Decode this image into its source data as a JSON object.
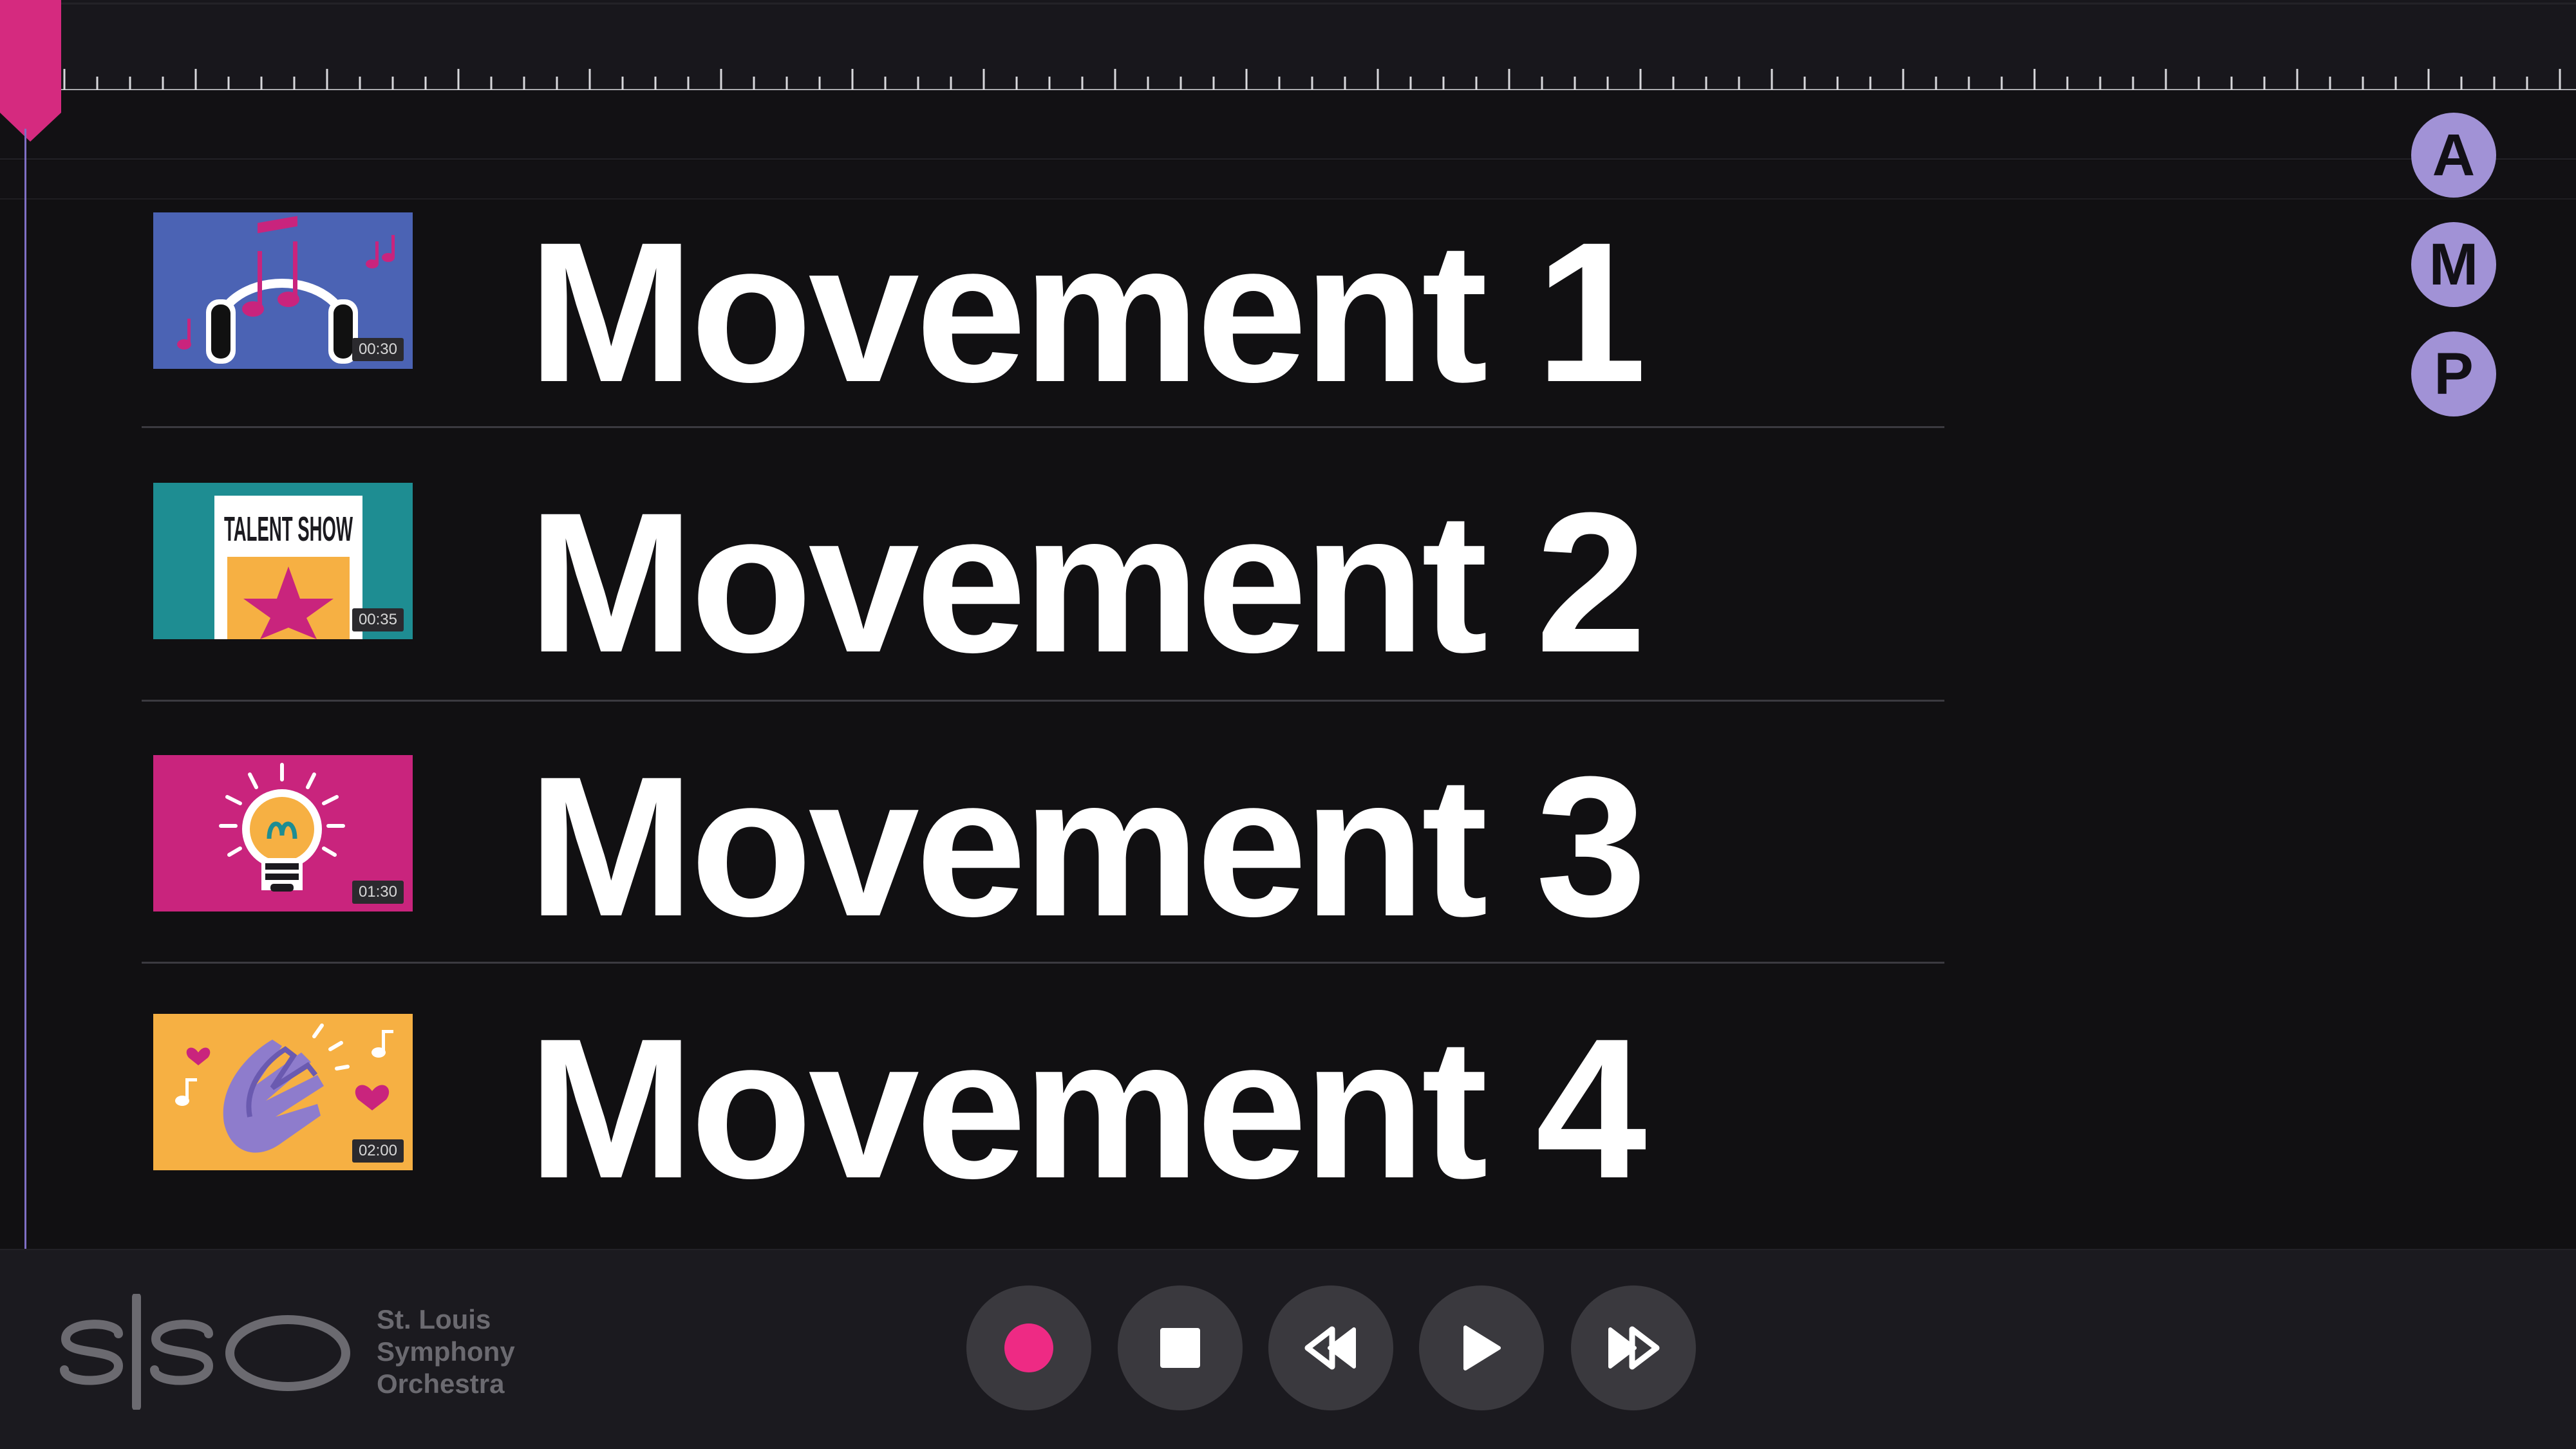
{
  "movements": [
    {
      "title": "Movement 1",
      "duration": "00:30",
      "thumbnail_icon": "headphones-music-icon"
    },
    {
      "title": "Movement 2",
      "duration": "00:35",
      "thumbnail_icon": "talent-show-poster-icon",
      "thumbnail_text": "TALENT SHOW"
    },
    {
      "title": "Movement 3",
      "duration": "01:30",
      "thumbnail_icon": "lightbulb-icon"
    },
    {
      "title": "Movement 4",
      "duration": "02:00",
      "thumbnail_icon": "clapping-hands-icon"
    }
  ],
  "amp": [
    "A",
    "M",
    "P"
  ],
  "logo": {
    "mark": "slso",
    "line1": "St. Louis",
    "line2": "Symphony",
    "line3": "Orchestra"
  },
  "transport": [
    "record-button",
    "stop-button",
    "rewind-button",
    "play-button",
    "fast-forward-button"
  ],
  "colors": {
    "accent": "#d52a7f",
    "record": "#ee2a84",
    "badge": "#a192d6",
    "playhead_line": "#7f6fc4",
    "thumb1_bg": "#4b63b4",
    "thumb2_bg": "#1e8d92",
    "thumb3_bg": "#c9247d",
    "thumb4_bg": "#f6b043"
  }
}
